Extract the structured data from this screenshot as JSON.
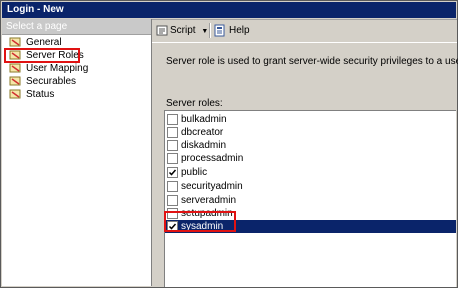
{
  "window": {
    "title": "Login - New"
  },
  "left_panel": {
    "header": "Select a page",
    "items": [
      {
        "label": "General"
      },
      {
        "label": "Server Roles"
      },
      {
        "label": "User Mapping"
      },
      {
        "label": "Securables"
      },
      {
        "label": "Status"
      }
    ]
  },
  "toolbar": {
    "script_label": "Script",
    "help_label": "Help"
  },
  "main": {
    "description": "Server role is used to grant server-wide security privileges to a user.",
    "roles_label": "Server roles:",
    "roles": [
      {
        "name": "bulkadmin",
        "checked": false
      },
      {
        "name": "dbcreator",
        "checked": false
      },
      {
        "name": "diskadmin",
        "checked": false
      },
      {
        "name": "processadmin",
        "checked": false
      },
      {
        "name": "public",
        "checked": true
      },
      {
        "name": "securityadmin",
        "checked": false
      },
      {
        "name": "serveradmin",
        "checked": false
      },
      {
        "name": "setupadmin",
        "checked": false
      },
      {
        "name": "sysadmin",
        "checked": true,
        "selected": true
      }
    ]
  },
  "colors": {
    "titlebar": "#0a246a",
    "highlight": "#e01212",
    "selection": "#0a246a"
  }
}
